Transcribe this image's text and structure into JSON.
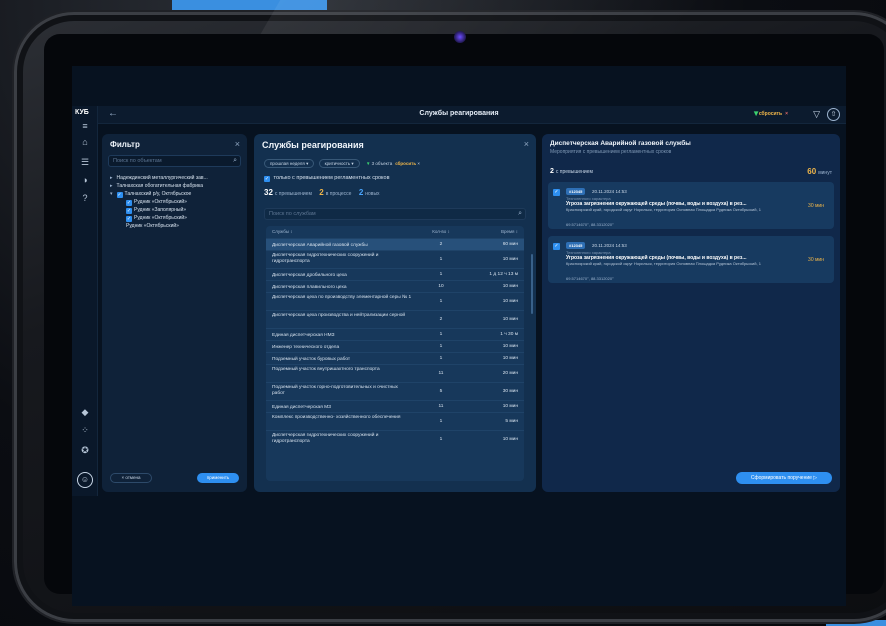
{
  "app": {
    "logo": "КУБ",
    "title": "Службы реагирования",
    "reset_label": "сбросить"
  },
  "rail_icons": [
    "menu-icon",
    "home-icon",
    "list-icon",
    "chart-icon",
    "help-icon",
    "bucket-icon",
    "grid-icon",
    "award-icon",
    "user-icon"
  ],
  "filter": {
    "title": "Фильтр",
    "search_placeholder": "Поиск по объектам",
    "tree": [
      {
        "label": "Надеждинский металлургический зав...",
        "level": 0,
        "checked": false
      },
      {
        "label": "Талнахская обогатительная фабрика",
        "level": 0,
        "checked": false
      },
      {
        "label": "Талнахский р/у, Октябрьское",
        "level": 0,
        "checked": true
      },
      {
        "label": "Рудник «Октябрьский»",
        "level": 1,
        "checked": true
      },
      {
        "label": "Рудник «Заполярный»",
        "level": 1,
        "checked": true
      },
      {
        "label": "Рудник «Октябрьский»",
        "level": 1,
        "checked": true
      },
      {
        "label": "Рудник «Октябрьский»",
        "level": 1,
        "checked": false
      }
    ],
    "reset_button": "× отмена",
    "apply_button": "применить"
  },
  "services": {
    "title": "Службы реагирования",
    "chips": [
      "прошлая неделя",
      "критичность"
    ],
    "objects_note": "3 объекта",
    "reset_label": "сбросить",
    "only_overdue_label": "только с превышением регламентных сроков",
    "stats": {
      "total": "32",
      "total_label": "с превышением",
      "in_progress": "2",
      "in_progress_label": "в процессе",
      "new": "2",
      "new_label": "новых"
    },
    "search_placeholder": "Поиск по службам",
    "columns": [
      "Службы ↕",
      "Кол-во ↕",
      "Время ↕"
    ],
    "rows": [
      {
        "name": "Диспетчерская Аварийной газовой службы",
        "count": "2",
        "time": "60 мин",
        "selected": true
      },
      {
        "name": "Диспетчерская гидротехнических сооружений и гидротранспорта",
        "count": "1",
        "time": "10 мин"
      },
      {
        "name": "Диспетчерская дробильного цеха",
        "count": "1",
        "time": "1 д 12 ч 13 м"
      },
      {
        "name": "Диспетчерская плавильного цеха",
        "count": "10",
        "time": "10 мин"
      },
      {
        "name": "Диспетчерская цеха по производству элементарной серы № 1",
        "count": "1",
        "time": "10 мин"
      },
      {
        "name": "Диспетчерская цеха производства и нейтрализации серной",
        "count": "2",
        "time": "10 мин"
      },
      {
        "name": "Единая диспетчерская НМЗ",
        "count": "1",
        "time": "1 ч 30 м"
      },
      {
        "name": "Инженер технического отдела",
        "count": "1",
        "time": "10 мин"
      },
      {
        "name": "Подземный участок буровых работ",
        "count": "1",
        "time": "10 мин"
      },
      {
        "name": "Подземный участок внутришахтного транспорта",
        "count": "11",
        "time": "20 мин"
      },
      {
        "name": "Подземный участок горно-подготовительных и очистных работ",
        "count": "5",
        "time": "30 мин"
      },
      {
        "name": "Единая диспетчерская МЗ",
        "count": "11",
        "time": "10 мин"
      },
      {
        "name": "Комплекс производственно- хозяйственного обеспечения",
        "count": "1",
        "time": "5 мин"
      },
      {
        "name": "Диспетчерская гидротехнических сооружений и гидротранспорта",
        "count": "1",
        "time": "10 мин"
      }
    ]
  },
  "detail": {
    "title": "Диспетчерская Аварийной газовой службы",
    "subtitle": "Мероприятия с превышением регламентных сроков",
    "count": "2",
    "count_label": "с превышением",
    "total": "60",
    "total_label": "минут",
    "cards": [
      {
        "tag": "#12345",
        "date": "20.11.2024 14:53",
        "kind": "Техногенного характера",
        "head": "Угроза загрязнения окружающей среды (почвы, воды и воздуха) в рез...",
        "addr": "Красноярский край, городской округ Норильск, территория Основная Площадка Рудника Октябрьский, 1",
        "coord": "69.5714670°, 88.3312020°",
        "mins": "30 мин"
      },
      {
        "tag": "#12345",
        "date": "20.11.2024 14:53",
        "kind": "Техногенного характера",
        "head": "Угроза загрязнения окружающей среды (почвы, воды и воздуха) в рез...",
        "addr": "Красноярский край, городской округ Норильск, территория Основная Площадка Рудника Октябрьский, 1",
        "coord": "69.5714670°, 88.3312020°",
        "mins": "30 мин"
      }
    ],
    "form_button": "Сформировать поручение"
  }
}
